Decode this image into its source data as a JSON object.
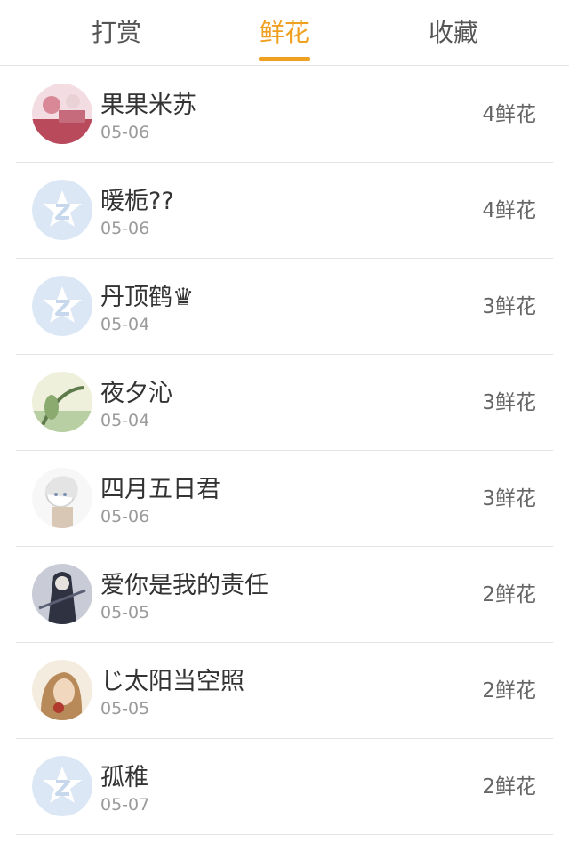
{
  "tabs": [
    {
      "label": "打赏",
      "active": false
    },
    {
      "label": "鲜花",
      "active": true
    },
    {
      "label": "收藏",
      "active": false
    }
  ],
  "accent_color": "#f0a020",
  "rows": [
    {
      "name": "果果米苏",
      "date": "05-06",
      "amount": "4鲜花",
      "avatar": "photo-pink"
    },
    {
      "name": "暖栀??",
      "date": "05-06",
      "amount": "4鲜花",
      "avatar": "default-qq-avatar"
    },
    {
      "name": "丹顶鹤♛",
      "date": "05-04",
      "amount": "3鲜花",
      "avatar": "default-qq-avatar"
    },
    {
      "name": "夜夕沁",
      "date": "05-04",
      "amount": "3鲜花",
      "avatar": "photo-green"
    },
    {
      "name": "四月五日君",
      "date": "05-06",
      "amount": "3鲜花",
      "avatar": "photo-white"
    },
    {
      "name": "爱你是我的责任",
      "date": "05-05",
      "amount": "2鲜花",
      "avatar": "photo-dark"
    },
    {
      "name": "じ太阳当空照",
      "date": "05-05",
      "amount": "2鲜花",
      "avatar": "photo-brown"
    },
    {
      "name": "孤稚",
      "date": "05-07",
      "amount": "2鲜花",
      "avatar": "default-qq-avatar"
    }
  ]
}
